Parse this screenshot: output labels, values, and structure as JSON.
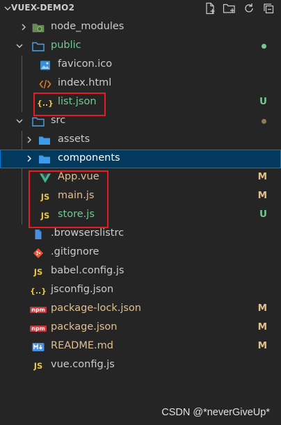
{
  "explorer": {
    "title": "VUEX-DEMO2",
    "actions": [
      "new-file-icon",
      "new-folder-icon",
      "refresh-icon",
      "collapse-all-icon"
    ]
  },
  "tree": [
    {
      "label": "node_modules",
      "icon": "node-folder-icon",
      "color": "#8c8c8c",
      "state": "collapsed",
      "badge": ""
    },
    {
      "label": "public",
      "icon": "folder-icon",
      "color": "#73c991",
      "state": "expanded",
      "badge": "dot",
      "badge_color": "#73c991"
    },
    {
      "label": "favicon.ico",
      "icon": "image-icon",
      "color": "#cccccc",
      "badge": ""
    },
    {
      "label": "index.html",
      "icon": "html-icon",
      "color": "#cccccc",
      "badge": ""
    },
    {
      "label": "list.json",
      "icon": "json-icon",
      "color": "#73c991",
      "badge": "U",
      "badge_color": "#73c991"
    },
    {
      "label": "src",
      "icon": "folder-icon",
      "color": "#cccccc",
      "state": "expanded",
      "badge": "dot",
      "badge_color": "#8e7a5b"
    },
    {
      "label": "assets",
      "icon": "folder-icon",
      "color": "#cccccc",
      "state": "collapsed",
      "badge": ""
    },
    {
      "label": "components",
      "icon": "folder-icon",
      "color": "#ffffff",
      "state": "collapsed",
      "badge": "",
      "selected": true
    },
    {
      "label": "App.vue",
      "icon": "vue-icon",
      "color": "#e2c08d",
      "badge": "M",
      "badge_color": "#e2c08d"
    },
    {
      "label": "main.js",
      "icon": "js-icon",
      "color": "#e2c08d",
      "badge": "M",
      "badge_color": "#e2c08d"
    },
    {
      "label": "store.js",
      "icon": "js-icon",
      "color": "#73c991",
      "badge": "U",
      "badge_color": "#73c991"
    },
    {
      "label": ".browserslistrc",
      "icon": "browserslist-icon",
      "color": "#cccccc",
      "badge": ""
    },
    {
      "label": ".gitignore",
      "icon": "git-icon",
      "color": "#cccccc",
      "badge": ""
    },
    {
      "label": "babel.config.js",
      "icon": "js-icon",
      "color": "#cccccc",
      "badge": ""
    },
    {
      "label": "jsconfig.json",
      "icon": "json-icon",
      "color": "#cccccc",
      "badge": ""
    },
    {
      "label": "package-lock.json",
      "icon": "npm-icon",
      "color": "#e2c08d",
      "badge": "M",
      "badge_color": "#e2c08d"
    },
    {
      "label": "package.json",
      "icon": "npm-icon",
      "color": "#e2c08d",
      "badge": "M",
      "badge_color": "#e2c08d"
    },
    {
      "label": "README.md",
      "icon": "markdown-icon",
      "color": "#e2c08d",
      "badge": "M",
      "badge_color": "#e2c08d"
    },
    {
      "label": "vue.config.js",
      "icon": "js-icon",
      "color": "#cccccc",
      "badge": ""
    }
  ],
  "watermark": "CSDN @*neverGiveUp*"
}
